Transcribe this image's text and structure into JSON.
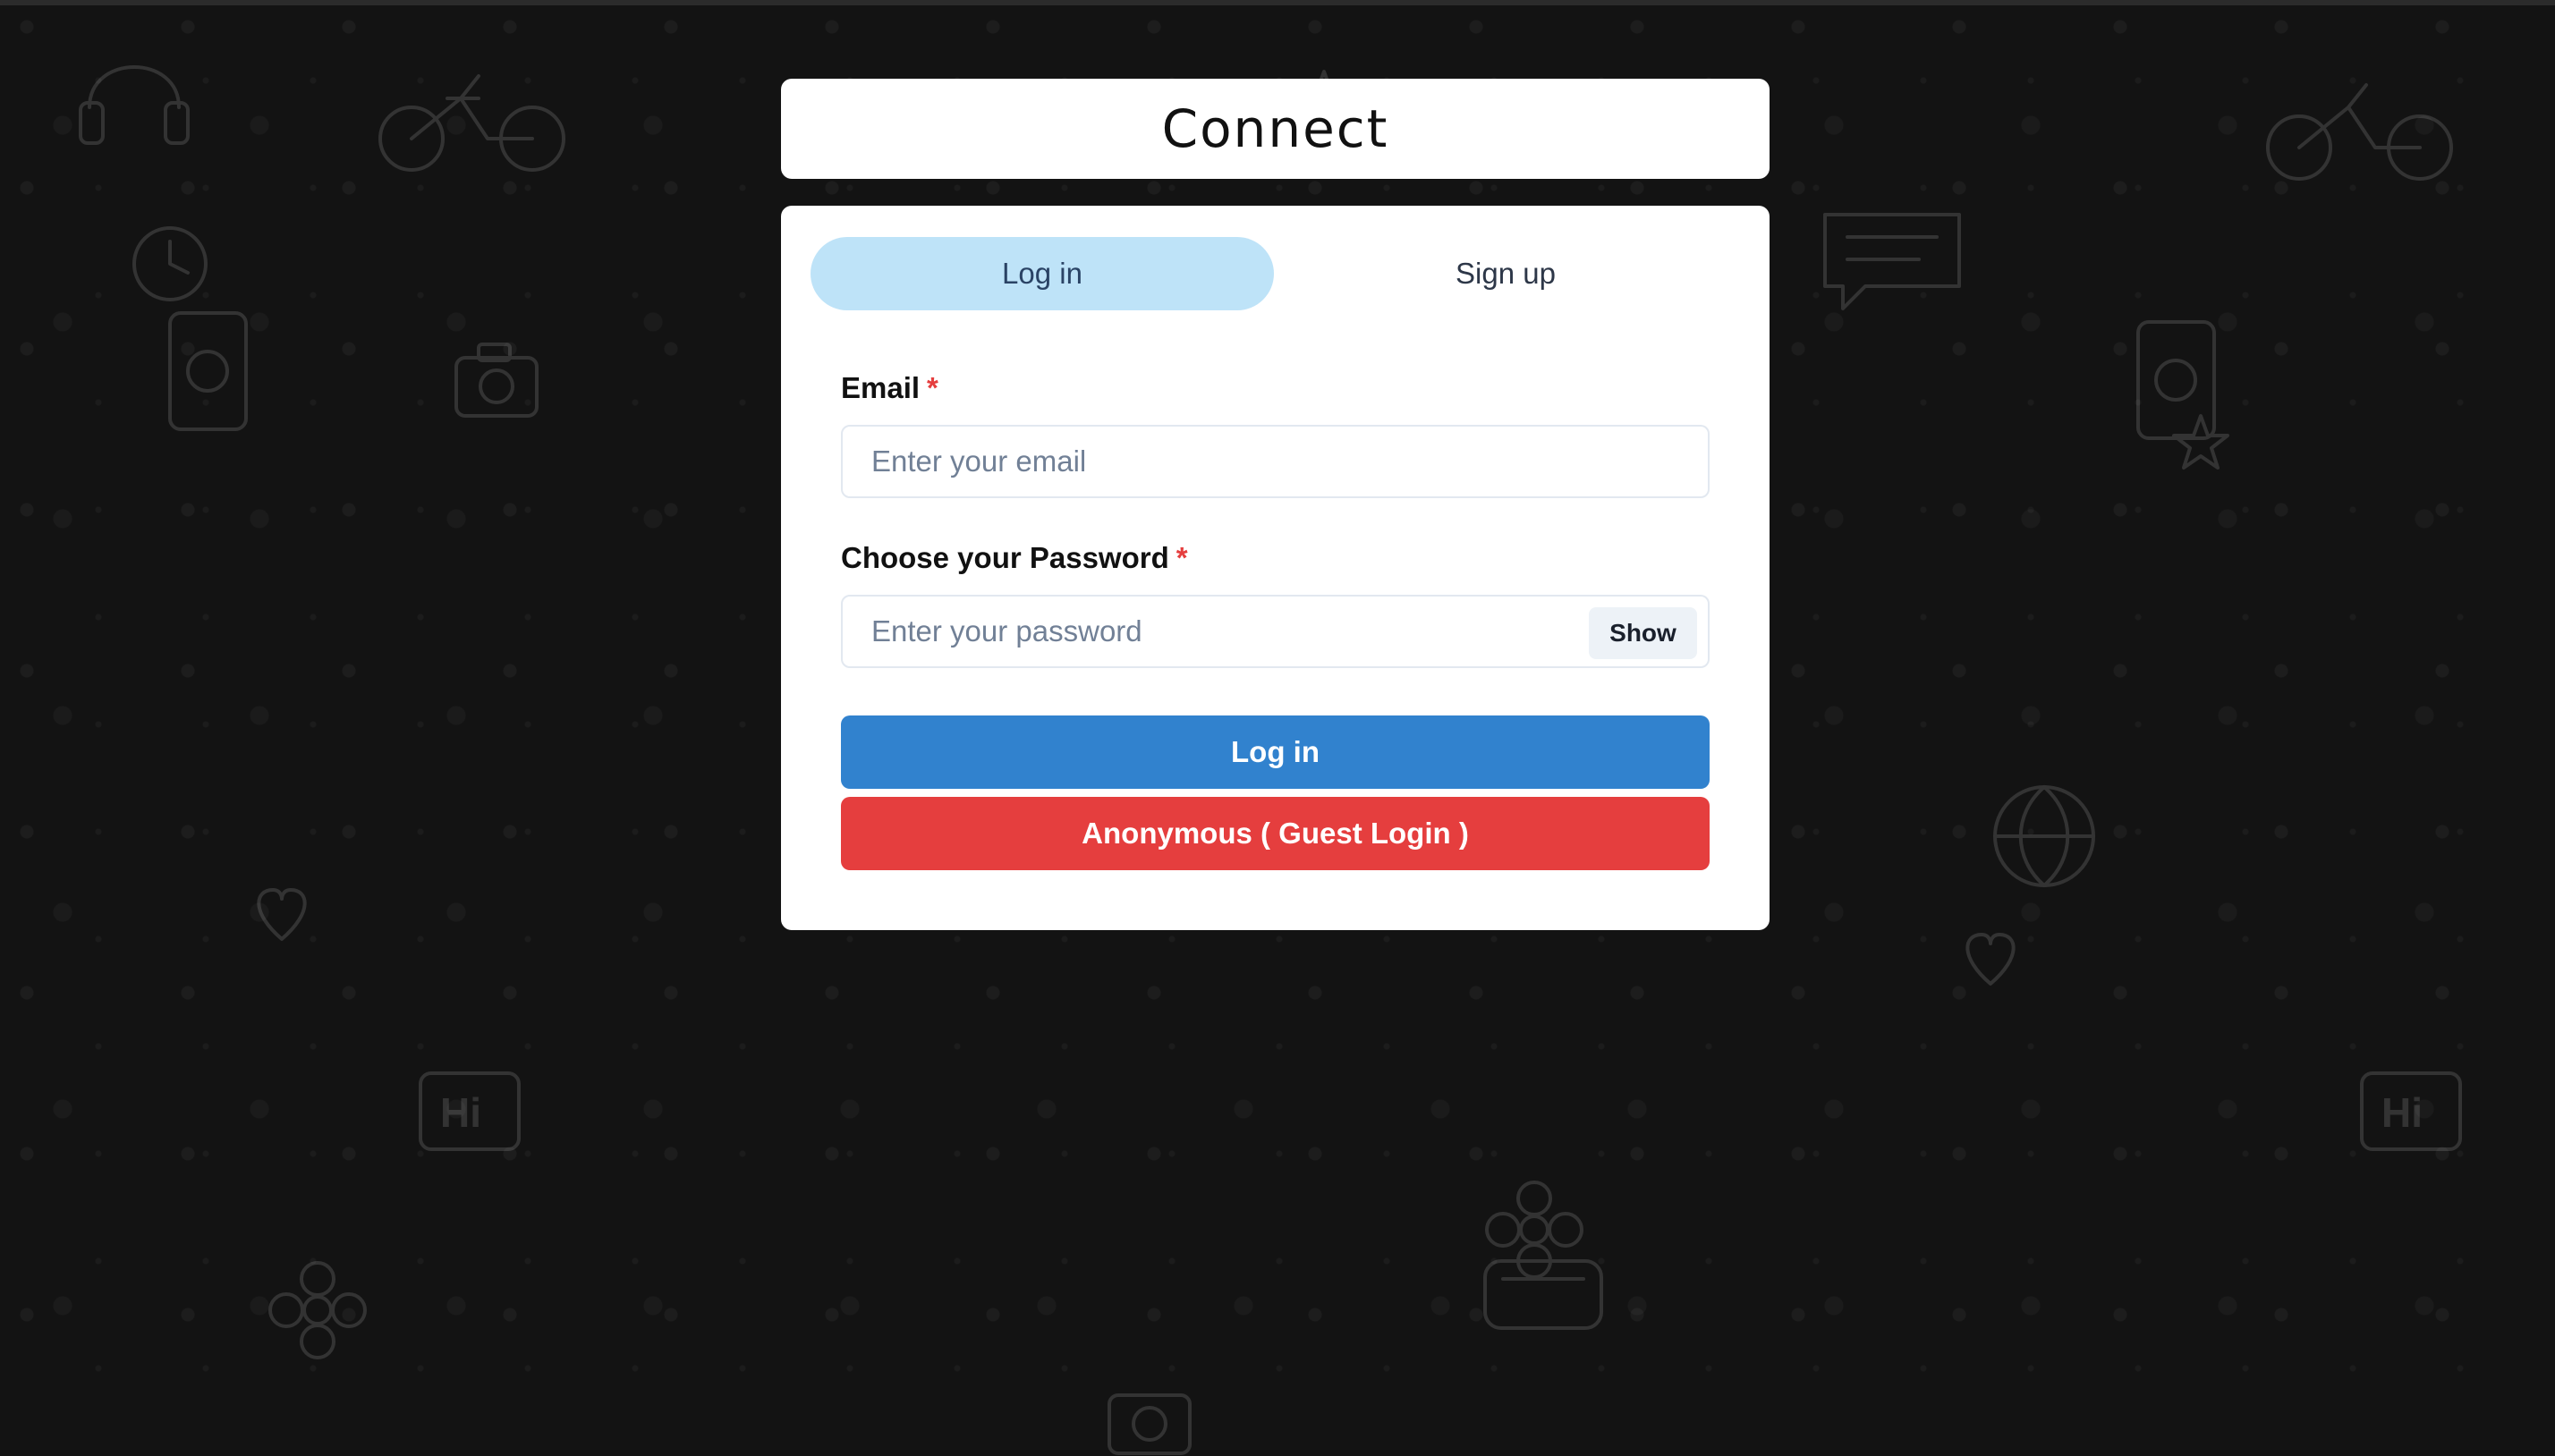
{
  "header": {
    "title": "Connect"
  },
  "tabs": [
    {
      "label": "Log in",
      "active": true
    },
    {
      "label": "Sign up",
      "active": false
    }
  ],
  "form": {
    "email": {
      "label": "Email",
      "required_mark": "*",
      "placeholder": "Enter your email",
      "value": ""
    },
    "password": {
      "label": "Choose your Password",
      "required_mark": "*",
      "placeholder": "Enter your password",
      "value": "",
      "toggle_label": "Show"
    }
  },
  "actions": {
    "login_label": "Log in",
    "guest_label": "Anonymous ( Guest Login )"
  },
  "colors": {
    "background": "#131313",
    "card": "#ffffff",
    "tab_active": "#bee3f8",
    "primary": "#3182ce",
    "danger": "#e53e3e",
    "required": "#e53e3e"
  },
  "background_icons": [
    "bicycle-icon",
    "camera-icon",
    "headphones-icon",
    "phone-icon",
    "clock-icon",
    "star-icon",
    "heart-icon",
    "chat-bubble-icon",
    "hi-bubble-icon",
    "flower-icon",
    "globe-icon",
    "alarm-clock-icon"
  ]
}
